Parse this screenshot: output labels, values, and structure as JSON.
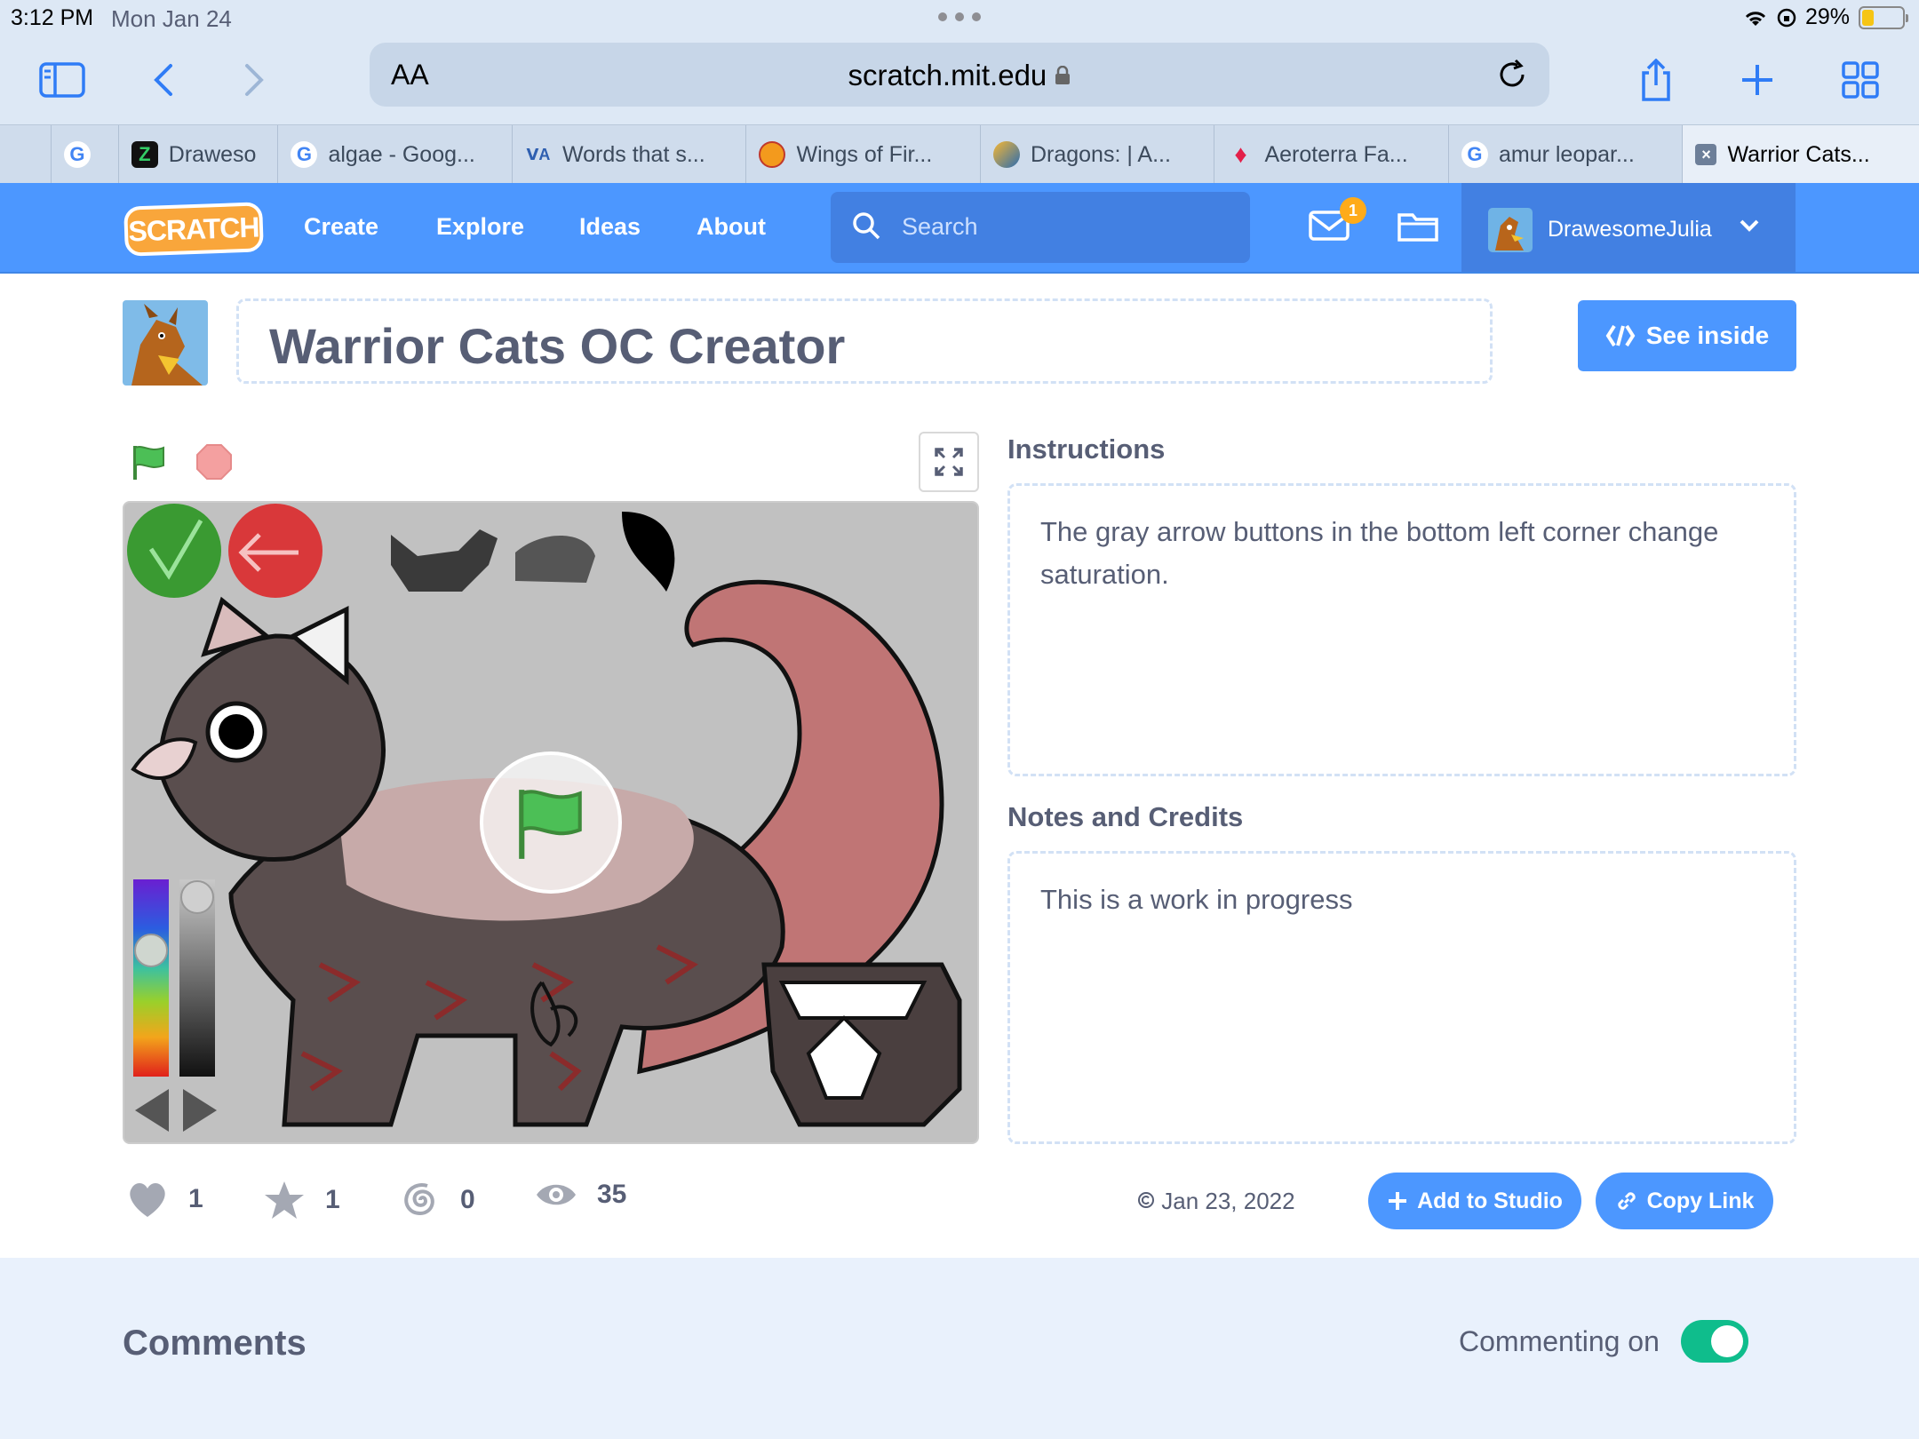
{
  "status": {
    "time": "3:12 PM",
    "date": "Mon Jan 24",
    "battery": "29%",
    "battery_level": 0.29
  },
  "browser": {
    "text_size_label": "AA",
    "url": "scratch.mit.edu",
    "tabs": [
      {
        "label": "",
        "icon": "google"
      },
      {
        "label": "Draweso",
        "icon": "drawesome"
      },
      {
        "label": "algae - Goog...",
        "icon": "google"
      },
      {
        "label": "Words that s...",
        "icon": "dictionary"
      },
      {
        "label": "Wings of Fir...",
        "icon": "wings"
      },
      {
        "label": "Dragons: | A...",
        "icon": "dragons"
      },
      {
        "label": "Aeroterra Fa...",
        "icon": "fandom"
      },
      {
        "label": "amur leopar...",
        "icon": "google"
      },
      {
        "label": "Warrior Cats...",
        "icon": "scratch"
      }
    ]
  },
  "nav": {
    "logo": "SCRATCH",
    "links": [
      "Create",
      "Explore",
      "Ideas",
      "About"
    ],
    "search_placeholder": "Search",
    "message_count": "1",
    "username": "DrawesomeJulia"
  },
  "project": {
    "title": "Warrior Cats OC Creator",
    "see_inside": "See inside",
    "stats": {
      "loves": "1",
      "favorites": "1",
      "remixes": "0",
      "views": "35"
    },
    "shared_date": "Jan 23, 2022",
    "add_to_studio": "Add to Studio",
    "copy_link": "Copy Link"
  },
  "instructions": {
    "heading": "Instructions",
    "text": "The gray arrow buttons in the bottom left corner change saturation."
  },
  "notes": {
    "heading": "Notes and Credits",
    "text": "This is a work in progress"
  },
  "comments": {
    "heading": "Comments",
    "toggle_label": "Commenting on",
    "enabled": true
  },
  "colors": {
    "brand_blue": "#4c97ff",
    "nav_dark": "#4280e2",
    "text": "#575e75",
    "green": "#0fbd8c",
    "logo_orange": "#f9a63b"
  }
}
